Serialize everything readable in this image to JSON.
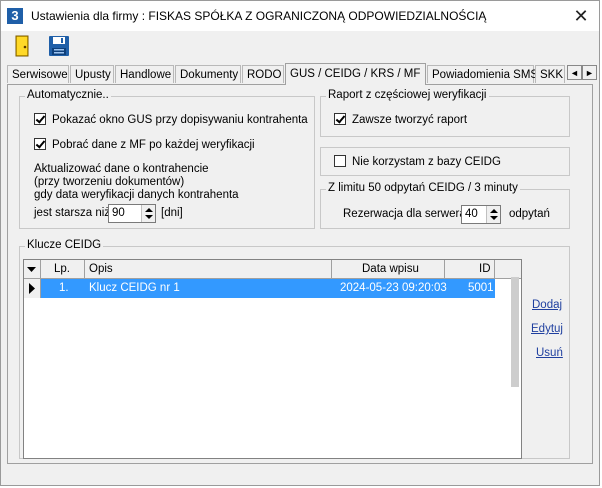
{
  "window": {
    "title": "Ustawienia dla firmy  : FISKAS SPÓŁKA Z OGRANICZONĄ ODPOWIEDZIALNOŚCIĄ",
    "app_icon_text": "3",
    "close_glyph": "✕"
  },
  "toolbar": {
    "buttons": [
      {
        "icon": "exit-door-icon"
      },
      {
        "icon": "save-floppy-icon"
      }
    ]
  },
  "tabs": [
    {
      "label": "Serwisowe"
    },
    {
      "label": "Upusty"
    },
    {
      "label": "Handlowe"
    },
    {
      "label": "Dokumenty"
    },
    {
      "label": "RODO"
    },
    {
      "label": "GUS / CEIDG / KRS / MF",
      "active": true
    },
    {
      "label": "Powiadomienia SMS"
    },
    {
      "label": "SKK"
    }
  ],
  "tab_scroll": {
    "left": "◄",
    "right": "►"
  },
  "auto_group": {
    "label": "Automatycznie..",
    "show_gus": {
      "label": "Pokazać okno GUS przy dopisywaniu kontrahenta",
      "checked": true
    },
    "fetch_mf": {
      "label": "Pobrać dane z MF po każdej weryfikacji",
      "checked": true
    },
    "update_text": [
      "Aktualizować dane o kontrahencie",
      "(przy tworzeniu dokumentów)",
      "gdy data weryfikacji danych kontrahenta"
    ],
    "older_label": "jest starsza niż",
    "older_value": "90",
    "older_unit": "[dni]"
  },
  "partial_group": {
    "label": "Raport z częściowej weryfikacji",
    "always": {
      "label": "Zawsze tworzyć raport",
      "checked": true
    }
  },
  "no_ceidg": {
    "label": "Nie korzystam z bazy CEIDG",
    "checked": false
  },
  "limit_group": {
    "label": "Z limitu 50 odpytań CEIDG / 3 minuty",
    "reserve_label": "Rezerwacja dla serwera",
    "reserve_value": "40",
    "reserve_unit": "odpytań"
  },
  "keys_group": {
    "label": "Klucze CEIDG",
    "columns": {
      "lp": "Lp.",
      "opis": "Opis",
      "data": "Data wpisu",
      "id": "ID"
    },
    "rows": [
      {
        "lp": "1.",
        "opis": "Klucz CEIDG nr 1",
        "data": "2024-05-23 09:20:03",
        "id": "5001",
        "selected": true
      }
    ],
    "actions": {
      "add": "Dodaj",
      "edit": "Edytuj",
      "delete": "Usuń"
    }
  },
  "colors": {
    "selection": "#3399ff",
    "link": "#1f3f9f",
    "icon_blue": "#1f5fa8"
  }
}
